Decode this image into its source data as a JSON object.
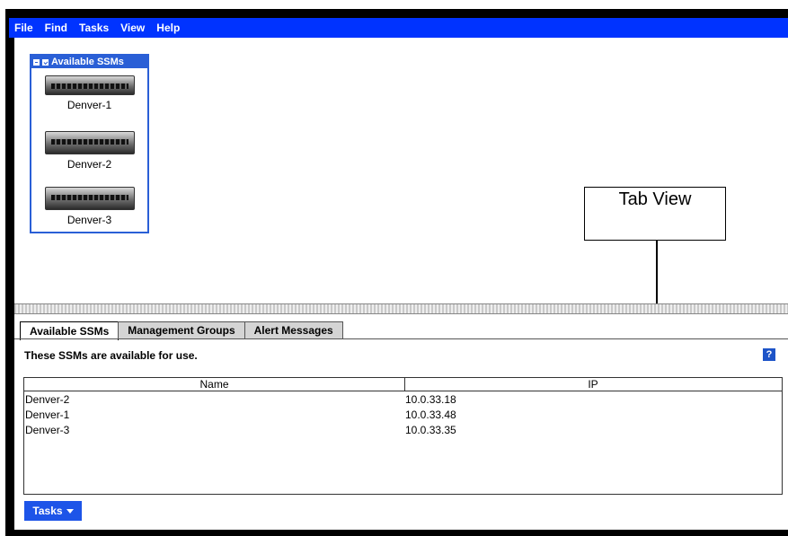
{
  "menu": {
    "items": [
      {
        "label": "File"
      },
      {
        "label": "Find"
      },
      {
        "label": "Tasks"
      },
      {
        "label": "View"
      },
      {
        "label": "Help"
      }
    ]
  },
  "map": {
    "title": "Available SSMs",
    "servers": [
      {
        "label": "Denver-1"
      },
      {
        "label": "Denver-2"
      },
      {
        "label": "Denver-3"
      }
    ]
  },
  "callout": {
    "text": "Tab View"
  },
  "tabs": [
    {
      "label": "Available SSMs"
    },
    {
      "label": "Management Groups"
    },
    {
      "label": "Alert Messages"
    }
  ],
  "panel": {
    "description": "These SSMs are available for use.",
    "help_glyph": "?",
    "table": {
      "columns": [
        "Name",
        "IP"
      ],
      "rows": [
        {
          "name": "Denver-2",
          "ip": "10.0.33.18"
        },
        {
          "name": "Denver-1",
          "ip": "10.0.33.48"
        },
        {
          "name": "Denver-3",
          "ip": "10.0.33.35"
        }
      ]
    },
    "tasks_button": "Tasks"
  },
  "colors": {
    "menubar": "#0033ff",
    "accent": "#2a5fd6",
    "tasks_button": "#1d54e8"
  }
}
